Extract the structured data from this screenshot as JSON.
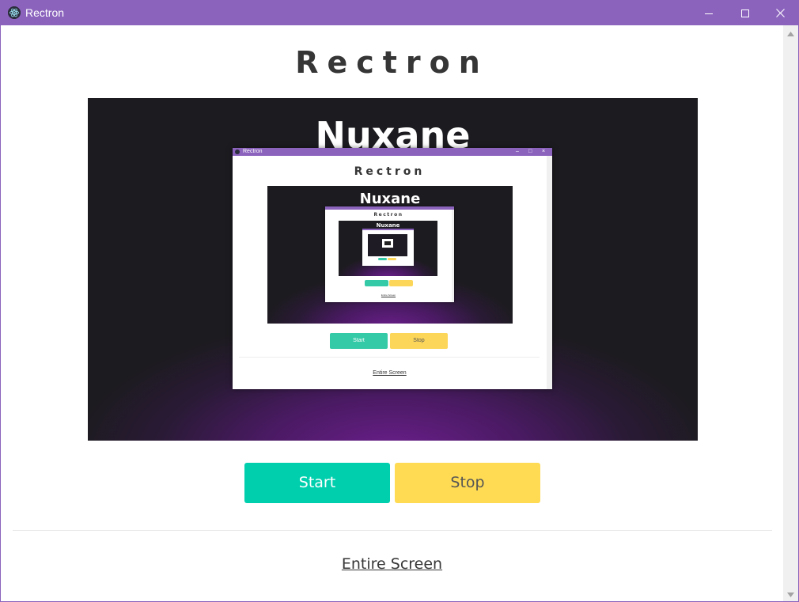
{
  "window": {
    "title": "Rectron",
    "controls": {
      "minimize": "minimize-icon",
      "maximize": "maximize-icon",
      "close": "close-icon"
    }
  },
  "page": {
    "title": "Rectron",
    "preview": {
      "logo_text": "Nuxane",
      "nested_window": {
        "title": "Rectron",
        "heading": "Rectron",
        "logo_text": "Nuxane",
        "start_label": "Start",
        "stop_label": "Stop",
        "source_label": "Entire Screen",
        "nested_window": {
          "heading": "Rectron",
          "logo_text": "Nuxane",
          "source_label": "Entire Screen"
        }
      }
    },
    "start_label": "Start",
    "stop_label": "Stop",
    "source_label": "Entire Screen"
  },
  "colors": {
    "titlebar": "#8b63bd",
    "start": "#00cfae",
    "stop": "#ffdb54",
    "preview_bg": "#1c1b1f",
    "preview_glow": "#6b1f8c"
  }
}
